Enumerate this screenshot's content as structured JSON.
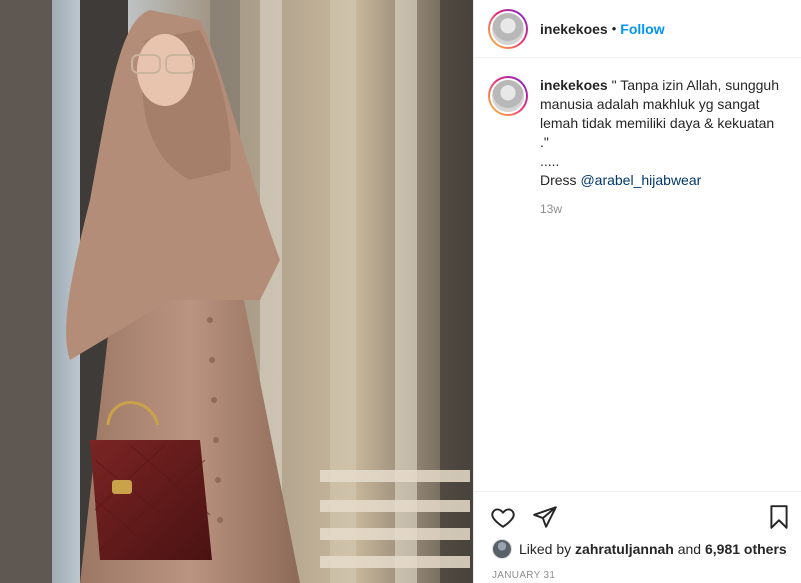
{
  "post": {
    "username": "inekekoes",
    "separator": "•",
    "follow_label": "Follow"
  },
  "caption": {
    "username": "inekekoes",
    "lines": [
      "\" Tanpa izin Allah, sungguh",
      "manusia adalah makhluk yg sangat",
      "lemah tidak memiliki daya & kekuatan",
      ".\"",
      "....."
    ],
    "dress_prefix": "Dress ",
    "mention": "@arabel_hijabwear",
    "time_ago": "13w"
  },
  "likes": {
    "prefix": "Liked by",
    "liker": "zahratuljannah",
    "middle": "and",
    "others": "6,981 others"
  },
  "date": "JANUARY 31",
  "icons": {
    "like": "heart-icon",
    "share": "paper-plane-icon",
    "save": "bookmark-icon"
  },
  "colors": {
    "follow": "#0095f6",
    "mention": "#00376b",
    "muted": "#8e8e8e",
    "text": "#262626",
    "divider": "#efefef"
  }
}
